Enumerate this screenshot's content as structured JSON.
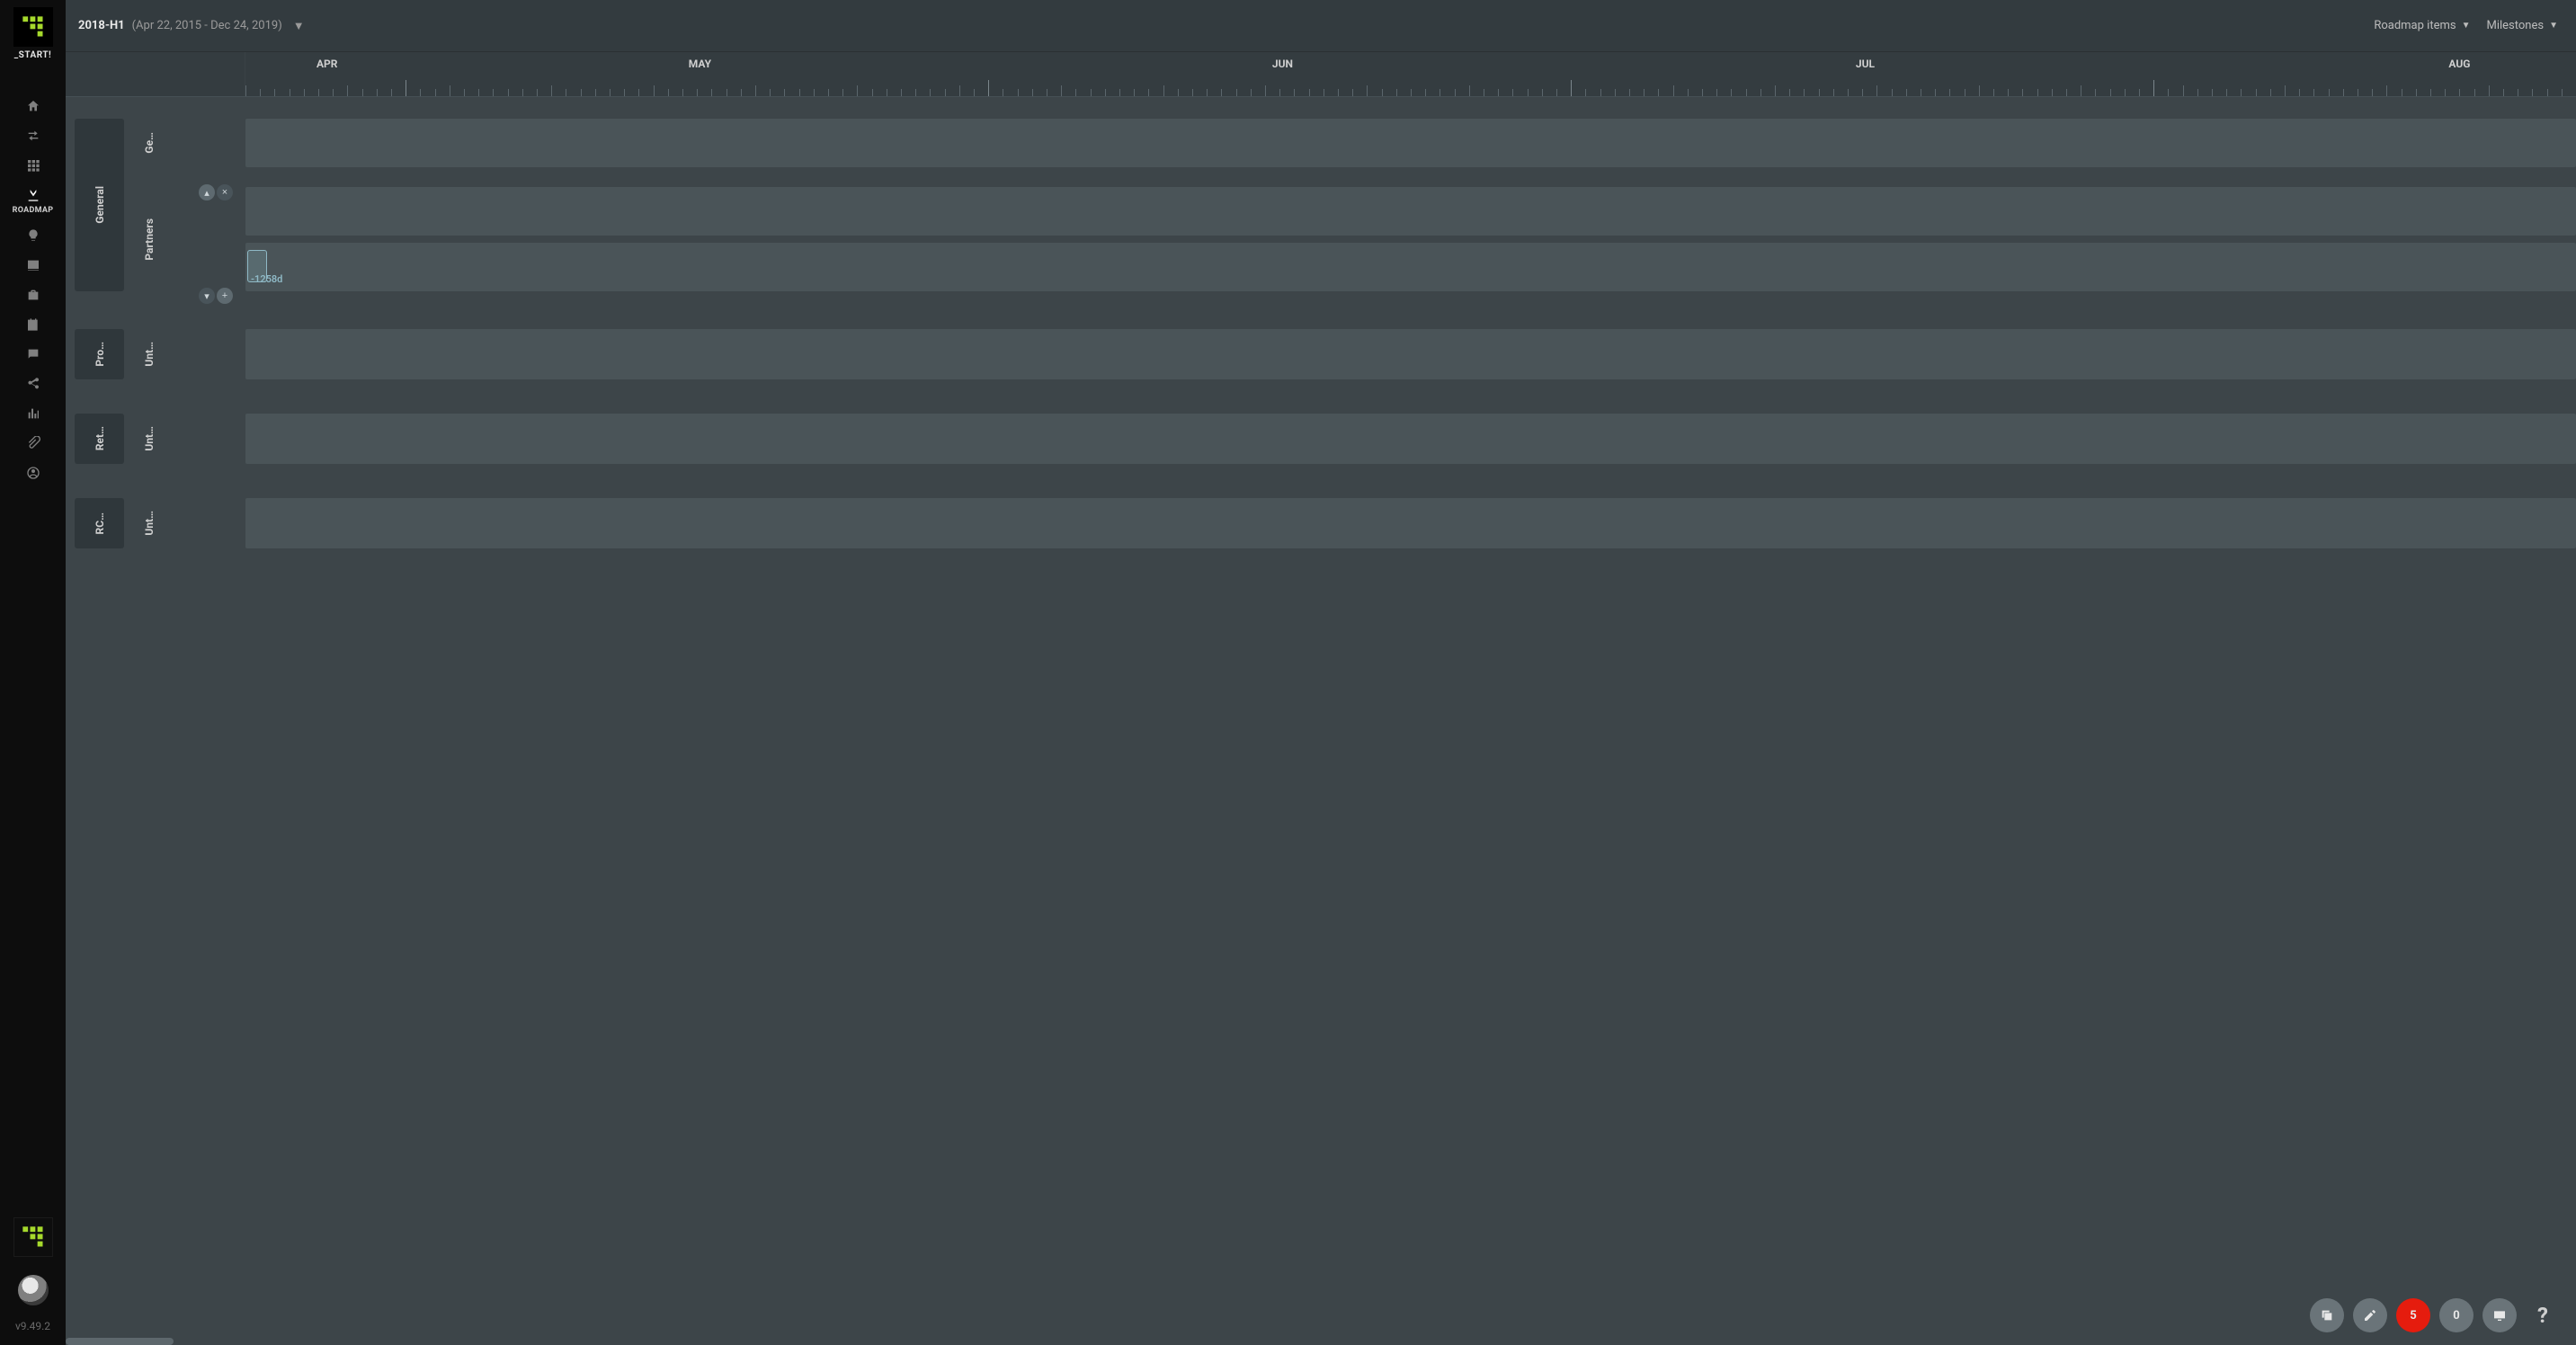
{
  "rail": {
    "project_label": "_START!",
    "active_label": "ROADMAP",
    "version": "v9.49.2"
  },
  "topbar": {
    "title": "2018-H1",
    "range": "(Apr 22, 2015 - Dec 24, 2019)",
    "menu_roadmap_items": "Roadmap items",
    "menu_milestones": "Milestones"
  },
  "ruler": {
    "months": [
      "APR",
      "MAY",
      "JUN",
      "JUL",
      "AUG"
    ]
  },
  "lanes": {
    "general": "General",
    "general_sub1": "Ge…",
    "general_sub2": "Partners",
    "pro": "Pro…",
    "pro_sub": "Unt…",
    "ret": "Ret…",
    "ret_sub": "Unt…",
    "rc": "RC…",
    "rc_sub": "Unt…"
  },
  "drag_chip_label": "-1258d",
  "fab": {
    "count_red": "5",
    "count_gray": "0"
  }
}
